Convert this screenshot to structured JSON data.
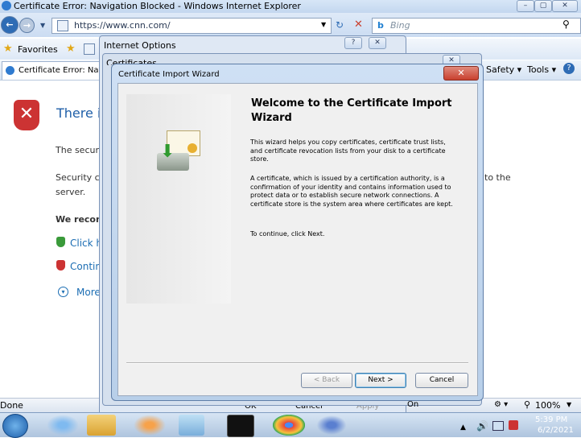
{
  "ie": {
    "title": "Certificate Error: Navigation Blocked - Windows Internet Explorer",
    "address": "https://www.cnn.com/",
    "search_placeholder": "Bing",
    "favorites_label": "Favorites",
    "tab_label": "Certificate Error: Navi",
    "menu": {
      "safety": "Safety ▾",
      "tools": "Tools ▾"
    },
    "status_left": "Done",
    "zoom": "100%"
  },
  "error_page": {
    "heading": "There is",
    "line1": "The secur",
    "line2a": "Security c",
    "line2b": "server.",
    "line2_right": "to the",
    "recommend": "We recon",
    "click_here": "Click h",
    "continue": "Contin",
    "more": "More"
  },
  "internet_options": {
    "title": "Internet Options",
    "ok": "OK",
    "cancel": "Cancel",
    "apply": "Apply"
  },
  "certificates": {
    "title": "Certificates",
    "snippet": "On"
  },
  "wizard": {
    "title": "Certificate Import Wizard",
    "heading": "Welcome to the Certificate Import Wizard",
    "para1": "This wizard helps you copy certificates, certificate trust lists, and certificate revocation lists from your disk to a certificate store.",
    "para2": "A certificate, which is issued by a certification authority, is a confirmation of your identity and contains information used to protect data or to establish secure network connections. A certificate store is the system area where certificates are kept.",
    "para3": "To continue, click Next.",
    "back": "< Back",
    "next": "Next >",
    "cancel": "Cancel"
  },
  "taskbar": {
    "time": "5:39 PM",
    "date": "6/2/2021"
  },
  "colors": {
    "accent": "#1f5fa8",
    "close_red": "#c9402f",
    "link": "#1b6db3"
  }
}
